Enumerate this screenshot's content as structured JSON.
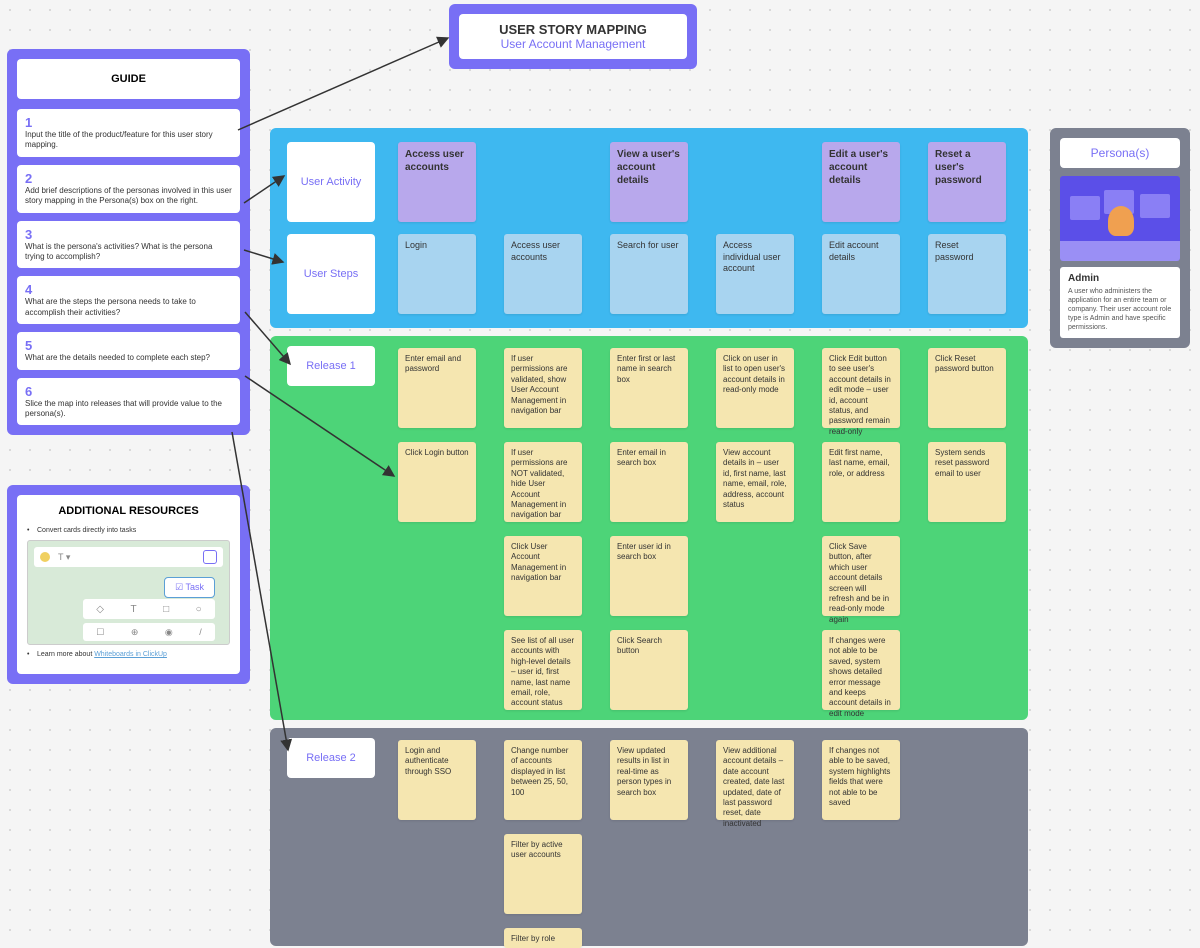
{
  "title": {
    "main": "USER STORY MAPPING",
    "sub": "User Account Management"
  },
  "guide": {
    "heading": "GUIDE",
    "items": [
      {
        "num": "1",
        "text": "Input the title of the product/feature for this user story mapping."
      },
      {
        "num": "2",
        "text": "Add brief descriptions of the personas involved in this user story mapping in the Persona(s) box on the right."
      },
      {
        "num": "3",
        "text": "What is the persona's activities? What is the persona trying to accomplish?"
      },
      {
        "num": "4",
        "text": "What are the steps the persona needs to take to accomplish their activities?"
      },
      {
        "num": "5",
        "text": "What are the details needed to complete each step?"
      },
      {
        "num": "6",
        "text": "Slice the map into releases that will provide value to the persona(s)."
      }
    ]
  },
  "resources": {
    "heading": "ADDITIONAL RESOURCES",
    "item1": "Convert cards directly into tasks",
    "task_label": "Task",
    "item2": "Learn more about ",
    "link": "Whiteboards in ClickUp"
  },
  "labels": {
    "user_activity": "User Activity",
    "user_steps": "User Steps",
    "release1": "Release 1",
    "release2": "Release 2"
  },
  "activities": [
    "Access user accounts",
    "View a user's account details",
    "Edit a user's account details",
    "Reset a user's password"
  ],
  "steps": [
    "Login",
    "Access user accounts",
    "Search for user",
    "Access individual user account",
    "Edit account details",
    "Reset password"
  ],
  "release1": {
    "rows": [
      [
        "Enter email and password",
        "If user permissions are validated, show User Account Management in navigation bar",
        "Enter first or last name in search box",
        "Click on user in list to open user's account details in read-only mode",
        "Click Edit button to see user's account details in edit mode – user id, account status, and password remain read-only",
        "Click Reset password button"
      ],
      [
        "Click Login button",
        "If user permissions are NOT validated, hide User Account Management in navigation bar",
        "Enter email in search box",
        "View account details in – user id, first name, last name, email, role, address, account status",
        "Edit first name, last name, email, role, or address",
        "System sends reset password email to user"
      ],
      [
        null,
        "Click User Account Management in navigation bar",
        "Enter user id in search box",
        null,
        "Click Save button, after which user account details screen will refresh and be in read-only mode again",
        null
      ],
      [
        null,
        "See list of all user accounts with high-level details – user id, first name, last name email, role, account status",
        "Click Search button",
        null,
        "If changes were not able to be saved, system shows detailed error message and keeps account details in edit mode",
        null
      ]
    ]
  },
  "release2": {
    "rows": [
      [
        "Login and authenticate through SSO",
        "Change number of accounts displayed in list between 25, 50, 100",
        "View updated results in list in real-time as person types in search box",
        "View additional account details – date account created, date last updated, date of last password reset, date inactivated",
        "If changes not able to be saved, system highlights fields that were not able to be saved",
        null
      ],
      [
        null,
        "Filter by active user accounts",
        null,
        null,
        null,
        null
      ],
      [
        null,
        "Filter by role",
        null,
        null,
        null,
        null
      ]
    ]
  },
  "persona": {
    "heading": "Persona(s)",
    "name": "Admin",
    "desc": "A user who administers the application for an entire team or company. Their user account role type is Admin and have specific permissions."
  }
}
